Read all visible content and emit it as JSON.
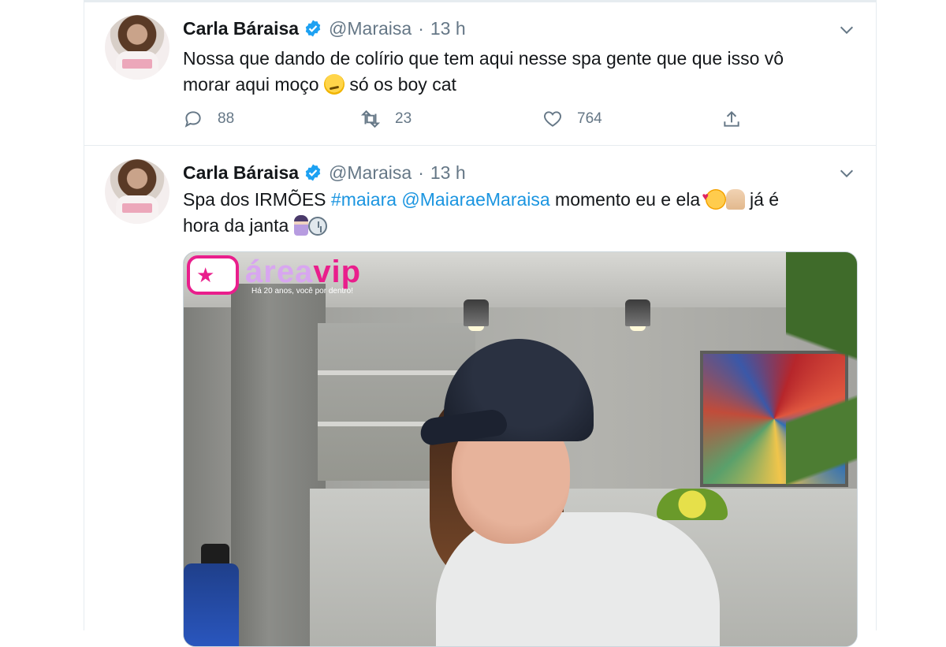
{
  "tweets": [
    {
      "name": "Carla Báraisa",
      "handle": "@Maraisa",
      "separator": "·",
      "time": "13 h",
      "text_line1": "Nossa que dando de colírio que tem aqui nesse spa gente que que isso vô",
      "text_line2_before": "morar aqui moço",
      "text_line2_after": "só os boy cat",
      "emojis": [
        "smirking-face-emoji"
      ],
      "counts": {
        "replies": "88",
        "retweets": "23",
        "likes": "764"
      }
    },
    {
      "name": "Carla Báraisa",
      "handle": "@Maraisa",
      "separator": "·",
      "time": "13 h",
      "text_prefix": "Spa dos IRMÕES ",
      "hashtag": "#maiara",
      "mention": "@MaiaraeMaraisa",
      "text_suffix": " momento eu e ela",
      "text_end": "já é",
      "text_line2": "hora da janta",
      "emojis": [
        "smiling-face-with-hearts-emoji",
        "folded-hands-emoji",
        "person-in-lotus-position-emoji",
        "clock-emoji"
      ]
    }
  ],
  "watermark": {
    "brand_prefix": "área",
    "brand_suffix": "vip",
    "badge_symbol": "★",
    "tagline": "Há 20 anos, você por dentro!"
  },
  "colors": {
    "link": "#1b95e0",
    "secondary_text": "#657786",
    "border": "#e6ecf0",
    "verified": "#1da1f2",
    "watermark_pink": "#e91e8c"
  }
}
